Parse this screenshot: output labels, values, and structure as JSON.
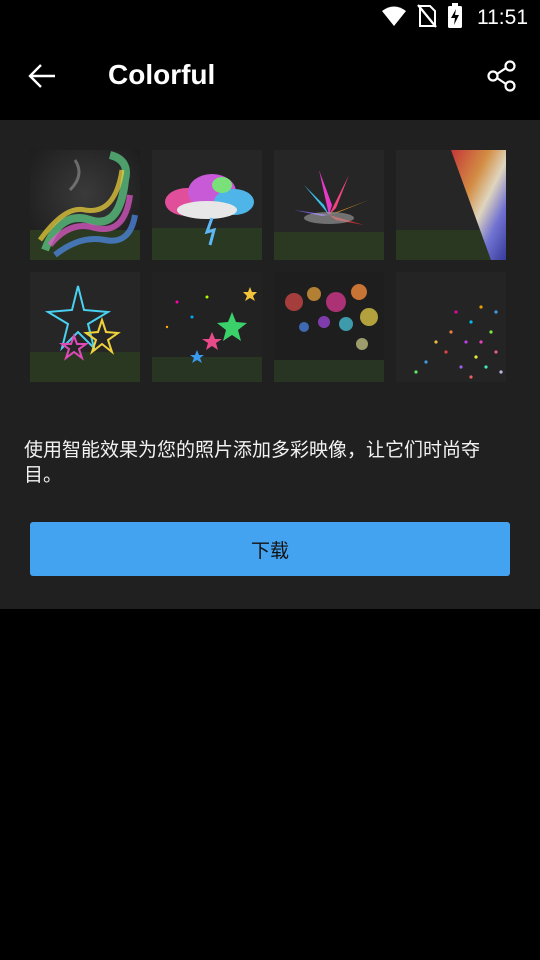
{
  "status_bar": {
    "time": "11:51",
    "icons": [
      "wifi-icon",
      "no-sim-icon",
      "battery-charging-icon"
    ]
  },
  "app_bar": {
    "title": "Colorful",
    "back_icon": "arrow-left-icon",
    "share_icon": "share-icon"
  },
  "gallery": {
    "thumbnails": [
      {
        "name": "rainbow-smoke"
      },
      {
        "name": "rainbow-cloud"
      },
      {
        "name": "color-burst"
      },
      {
        "name": "light-leak"
      },
      {
        "name": "neon-stars"
      },
      {
        "name": "colorful-stars"
      },
      {
        "name": "bokeh-lights"
      },
      {
        "name": "glitter"
      }
    ]
  },
  "description": "使用智能效果为您的照片添加多彩映像，让它们时尚夺目。",
  "download_button": {
    "label": "下载",
    "color": "#44a3f0"
  }
}
